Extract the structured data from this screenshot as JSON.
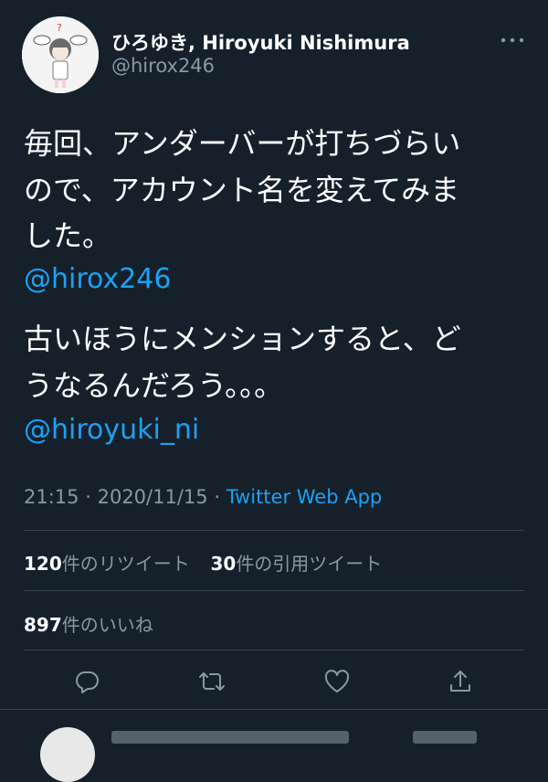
{
  "author": {
    "display_name": "ひろゆき, Hiroyuki Nishimura",
    "handle": "@hirox246"
  },
  "tweet": {
    "text_lines": [
      "毎回、アンダーバーが打ちづらい",
      "ので、アカウント名を変えてみま",
      "した。"
    ],
    "mention_1": "@hirox246",
    "text_lines_2": [
      "古いほうにメンションすると、ど",
      "うなるんだろう。。。"
    ],
    "mention_2": "@hiroyuki_ni",
    "time": "21:15",
    "date": "2020/11/15",
    "separator": "·",
    "source": "Twitter Web App"
  },
  "stats": {
    "retweets_count": "120",
    "retweets_label": "件のリツイート",
    "quotes_count": "30",
    "quotes_label": "件の引用ツイート",
    "likes_count": "897",
    "likes_label": "件のいいね"
  },
  "icons": {
    "more": "more-dots-icon",
    "reply": "reply-icon",
    "retweet": "retweet-icon",
    "like": "heart-icon",
    "share": "share-icon"
  },
  "colors": {
    "background": "#15202b",
    "link": "#1da1f2",
    "secondary_text": "#8899a6",
    "divider": "#38444d"
  }
}
